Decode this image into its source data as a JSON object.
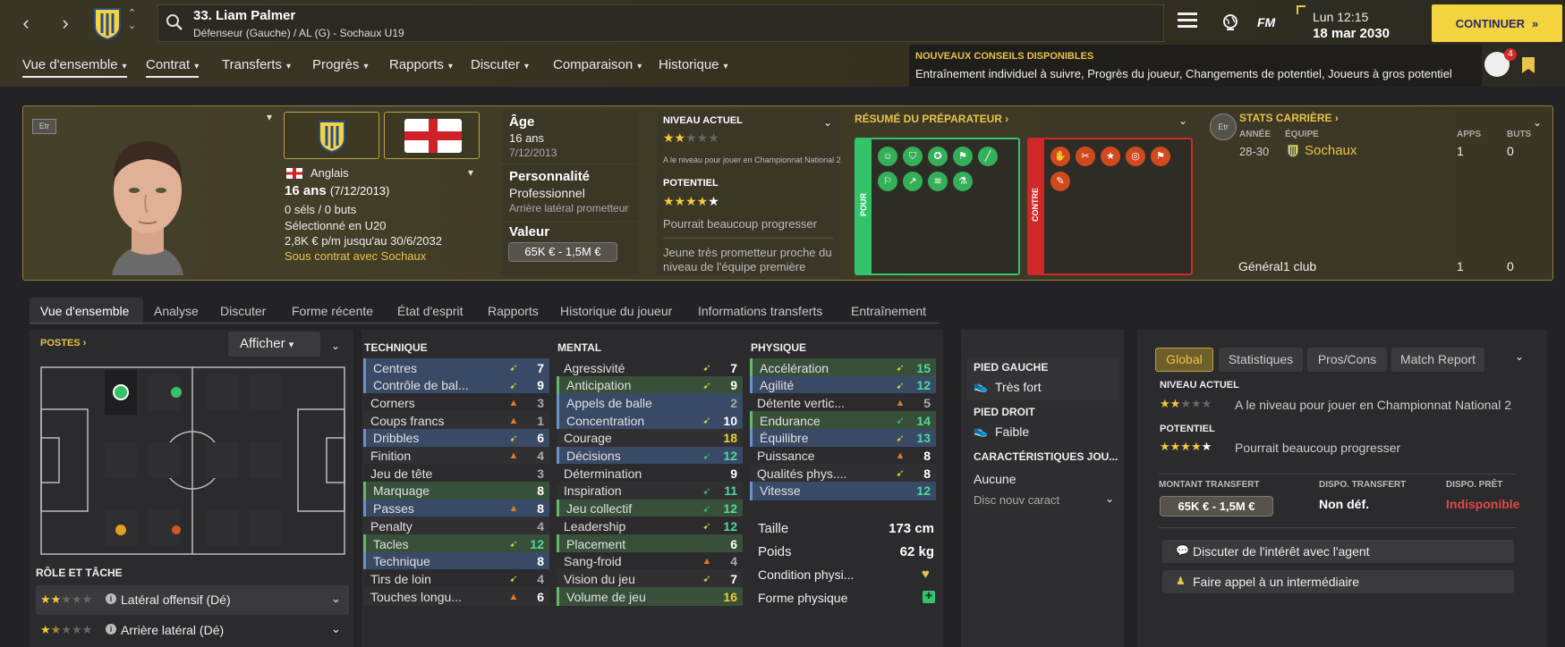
{
  "player": {
    "title": "33. Liam Palmer",
    "subtitle": "Défenseur (Gauche) / AL (G) - Sochaux U19"
  },
  "top": {
    "time": "Lun 12:15",
    "date": "18 mar 2030",
    "continue": "CONTINUER",
    "fm": "FM"
  },
  "menu": [
    "Vue d'ensemble",
    "Contrat",
    "Transferts",
    "Progrès",
    "Rapports",
    "Discuter",
    "Comparaison",
    "Historique"
  ],
  "news": {
    "title": "NOUVEAUX CONSEILS DISPONIBLES",
    "text": "Entraînement individuel à suivre, Progrès du joueur, Changements de potentiel, Joueurs à gros potentiel",
    "badge": "4"
  },
  "bio": {
    "etr": "Etr",
    "nation": "Anglais",
    "age_line": "16 ans",
    "age_date": "(7/12/2013)",
    "caps": "0 séls / 0 buts",
    "selected": "Sélectionné en U20",
    "wage": "2,8K € p/m jusqu'au 30/6/2032",
    "contract": "Sous contrat avec Sochaux"
  },
  "age": {
    "label": "Âge",
    "value": "16 ans",
    "date": "7/12/2013"
  },
  "personality": {
    "label": "Personnalité",
    "value": "Professionnel",
    "role": "Arrière latéral prometteur"
  },
  "value": {
    "label": "Valeur",
    "range": "65K € - 1,5M €"
  },
  "ability": {
    "current_label": "NIVEAU ACTUEL",
    "current_stars": 2,
    "current_text": "A le niveau pour jouer en Championnat National 2",
    "potential_label": "POTENTIEL",
    "potential_stars": 4,
    "potential_text": "Pourrait beaucoup progresser",
    "summary": "Jeune très prometteur proche du niveau de l'équipe première"
  },
  "coach": {
    "title": "RÉSUMÉ DU PRÉPARATEUR",
    "pour": "POUR",
    "contre": "CONTRE"
  },
  "career": {
    "title": "STATS CARRIÈRE",
    "col_year": "ANNÉE",
    "col_team": "ÉQUIPE",
    "col_apps": "APPS",
    "col_goals": "BUTS",
    "year": "28-30",
    "team": "Sochaux",
    "apps": "1",
    "goals": "0",
    "total_label": "Général",
    "total_team": "1 club",
    "total_apps": "1",
    "total_goals": "0"
  },
  "tabs": [
    "Vue d'ensemble",
    "Analyse",
    "Discuter",
    "Forme récente",
    "État d'esprit",
    "Rapports",
    "Historique du joueur",
    "Informations transferts",
    "Entraînement"
  ],
  "positions": {
    "title": "POSTES",
    "show": "Afficher"
  },
  "role": {
    "title": "RÔLE ET TÂCHE",
    "r1": "Latéral offensif (Dé)",
    "r1_stars": 2,
    "r2": "Arrière latéral (Dé)",
    "r2_stars": 1.5
  },
  "technique": {
    "title": "TECHNIQUE",
    "rows": [
      {
        "n": "Centres",
        "v": "7",
        "a": "up",
        "h": "blue"
      },
      {
        "n": "Contrôle de bal...",
        "v": "9",
        "a": "up",
        "h": "blue"
      },
      {
        "n": "Corners",
        "v": "3",
        "a": "flat",
        "h": "plain"
      },
      {
        "n": "Coups francs",
        "v": "1",
        "a": "flat",
        "h": "alt"
      },
      {
        "n": "Dribbles",
        "v": "6",
        "a": "up",
        "h": "blue"
      },
      {
        "n": "Finition",
        "v": "4",
        "a": "flat",
        "h": "alt"
      },
      {
        "n": "Jeu de tête",
        "v": "3",
        "a": "",
        "h": "plain"
      },
      {
        "n": "Marquage",
        "v": "8",
        "a": "",
        "h": "green"
      },
      {
        "n": "Passes",
        "v": "8",
        "a": "flat",
        "h": "blue"
      },
      {
        "n": "Penalty",
        "v": "4",
        "a": "",
        "h": "alt"
      },
      {
        "n": "Tacles",
        "v": "12",
        "a": "up",
        "h": "green"
      },
      {
        "n": "Technique",
        "v": "8",
        "a": "",
        "h": "blue"
      },
      {
        "n": "Tirs de loin",
        "v": "4",
        "a": "up",
        "h": "plain"
      },
      {
        "n": "Touches longu...",
        "v": "6",
        "a": "flat",
        "h": "alt"
      }
    ]
  },
  "mental": {
    "title": "MENTAL",
    "rows": [
      {
        "n": "Agressivité",
        "v": "7",
        "a": "up",
        "h": "plain"
      },
      {
        "n": "Anticipation",
        "v": "9",
        "a": "up",
        "h": "green"
      },
      {
        "n": "Appels de balle",
        "v": "2",
        "a": "",
        "h": "blue"
      },
      {
        "n": "Concentration",
        "v": "10",
        "a": "up",
        "h": "blue"
      },
      {
        "n": "Courage",
        "v": "18",
        "a": "",
        "h": "alt"
      },
      {
        "n": "Décisions",
        "v": "12",
        "a": "up2",
        "h": "blue"
      },
      {
        "n": "Détermination",
        "v": "9",
        "a": "",
        "h": "plain"
      },
      {
        "n": "Inspiration",
        "v": "11",
        "a": "up2",
        "h": "alt"
      },
      {
        "n": "Jeu collectif",
        "v": "12",
        "a": "up2",
        "h": "green"
      },
      {
        "n": "Leadership",
        "v": "12",
        "a": "up",
        "h": "plain"
      },
      {
        "n": "Placement",
        "v": "6",
        "a": "",
        "h": "green"
      },
      {
        "n": "Sang-froid",
        "v": "4",
        "a": "flat",
        "h": "plain"
      },
      {
        "n": "Vision du jeu",
        "v": "7",
        "a": "up",
        "h": "alt"
      },
      {
        "n": "Volume de jeu",
        "v": "16",
        "a": "",
        "h": "green"
      }
    ]
  },
  "physique": {
    "title": "PHYSIQUE",
    "rows": [
      {
        "n": "Accélération",
        "v": "15",
        "a": "up",
        "h": "green"
      },
      {
        "n": "Agilité",
        "v": "12",
        "a": "up",
        "h": "blue"
      },
      {
        "n": "Détente vertic...",
        "v": "5",
        "a": "flat",
        "h": "plain"
      },
      {
        "n": "Endurance",
        "v": "14",
        "a": "up2",
        "h": "green"
      },
      {
        "n": "Équilibre",
        "v": "13",
        "a": "up",
        "h": "blue"
      },
      {
        "n": "Puissance",
        "v": "8",
        "a": "flat",
        "h": "plain"
      },
      {
        "n": "Qualités phys....",
        "v": "8",
        "a": "up",
        "h": "alt"
      },
      {
        "n": "Vitesse",
        "v": "12",
        "a": "",
        "h": "blue"
      }
    ],
    "height_label": "Taille",
    "height": "173 cm",
    "weight_label": "Poids",
    "weight": "62 kg",
    "condition": "Condition physi...",
    "form": "Forme physique"
  },
  "feet": {
    "left_label": "PIED GAUCHE",
    "left": "Très fort",
    "right_label": "PIED DROIT",
    "right": "Faible",
    "traits_label": "CARACTÉRISTIQUES JOU...",
    "traits": "Aucune",
    "traits_select": "Disc nouv caract"
  },
  "right": {
    "tabs": [
      "Global",
      "Statistiques",
      "Pros/Cons",
      "Match Report"
    ],
    "current_label": "NIVEAU ACTUEL",
    "current_text": "A le niveau pour jouer en Championnat National 2",
    "potential_label": "POTENTIEL",
    "potential_text": "Pourrait beaucoup progresser",
    "transfer_label": "MONTANT TRANSFERT",
    "transfer": "65K € - 1,5M €",
    "dispo_t_label": "DISPO. TRANSFERT",
    "dispo_t": "Non déf.",
    "dispo_p_label": "DISPO. PRÊT",
    "dispo_p": "Indisponible",
    "btn1": "Discuter de l'intérêt avec l'agent",
    "btn2": "Faire appel à un intermédiaire"
  },
  "colors": {
    "accent": "#f3d43f",
    "gold": "#e8c34a",
    "green": "#34c36a",
    "red": "#d02828",
    "blue_row": "#394a66",
    "green_row": "#38503a"
  }
}
